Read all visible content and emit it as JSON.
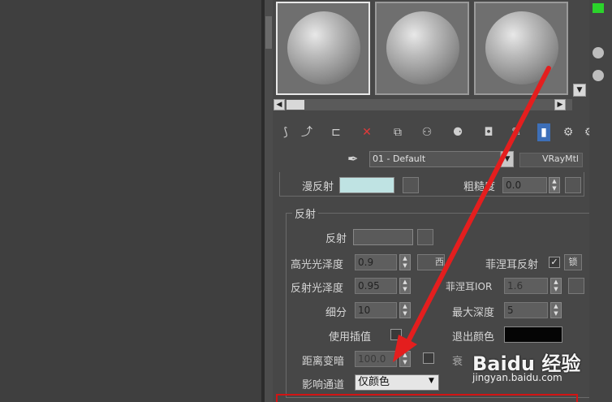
{
  "material_slots": [
    {
      "selected": true
    },
    {
      "selected": false
    },
    {
      "selected": false
    }
  ],
  "toolbar": {
    "icons": [
      "get-material-icon",
      "put-to-scene-icon",
      "assign-icon",
      "delete-icon",
      "copy-icon",
      "unique-icon",
      "put-library-icon",
      "effects-channel-icon",
      "show-map-icon",
      "show-result-icon",
      "go-parent-icon",
      "go-sibling-icon"
    ]
  },
  "material": {
    "name": "01 - Default",
    "type": "VRayMtl"
  },
  "diffuse": {
    "label": "漫反射",
    "color": "#bfe3e3",
    "roughness_label": "粗糙度",
    "roughness": "0.0"
  },
  "reflection": {
    "group_title": "反射",
    "reflect_label": "反射",
    "reflect_color": "#5a5a5a",
    "hilight_gloss_label": "高光光泽度",
    "hilight_gloss": "0.9",
    "lock_btn": "西",
    "fresnel_label": "菲涅耳反射",
    "fresnel_checked": "✓",
    "fresnel_lock": "锁",
    "refl_gloss_label": "反射光泽度",
    "refl_gloss": "0.95",
    "fresnel_ior_label": "菲涅耳IOR",
    "fresnel_ior": "1.6",
    "subdivs_label": "细分",
    "subdivs": "10",
    "max_depth_label": "最大深度",
    "max_depth": "5",
    "use_interp_label": "使用插值",
    "exit_color_label": "退出颜色",
    "exit_color": "#050505",
    "dim_distance_label": "距离变暗",
    "dim_distance": "100.0",
    "dim_falloff_label": "衰",
    "affect_channels_label": "影响通道",
    "affect_channels": "仅颜色"
  },
  "watermark": {
    "logo": "Baidu 经验",
    "url": "jingyan.baidu.com"
  }
}
